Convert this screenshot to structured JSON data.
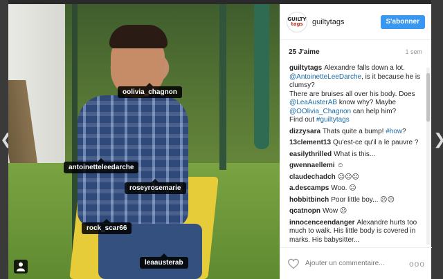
{
  "nav": {
    "prev_arrow": "❮",
    "next_arrow": "❯"
  },
  "photo": {
    "tags": [
      {
        "name": "oolivia_chagnon"
      },
      {
        "name": "antoinetteleedarche"
      },
      {
        "name": "roseyrosemarie"
      },
      {
        "name": "rock_scar66"
      },
      {
        "name": "leaausterab"
      }
    ]
  },
  "header": {
    "avatar_text_a": "GUILTY",
    "avatar_text_b": "tags",
    "username": "guiltytags",
    "follow_label": "S'abonner"
  },
  "stats": {
    "likes": "25 J'aime",
    "ago": "1 sem"
  },
  "caption": {
    "user": "guiltytags",
    "t1": "Alexandre falls down a lot. ",
    "m1": "@AntoinetteLeeDarche",
    "t2": ", is it because he is clumsy?",
    "t3": "There are bruises all over his body. Does ",
    "m2": "@LeaAusterAB",
    "t4": " know why? Maybe ",
    "m3": "@OOlivia_Chagnon",
    "t5": " can help him?",
    "t6": "Find out ",
    "h1": "#guiltytags"
  },
  "comments": [
    {
      "user": "dizzysara",
      "text": "Thats quite a bump! ",
      "tag": "#how",
      "after": "?"
    },
    {
      "user": "13clement13",
      "text": "Qu'est-ce qu'il a le pauvre ?"
    },
    {
      "user": "easilythrilled",
      "text": "What is this..."
    },
    {
      "user": "gwennaellemi",
      "text": "☺"
    },
    {
      "user": "claudechadch",
      "text": "☹☹☹"
    },
    {
      "user": "a.descamps",
      "text": "Woo. ☹"
    },
    {
      "user": "hobbitbinch",
      "text": "Poor little boy... ☹☹"
    },
    {
      "user": "qcatnopn",
      "text": "Wow ☹"
    },
    {
      "user": "innocenceendanger",
      "text": "Alexandre hurts too much to walk. His little body is covered in marks. His babysitter..."
    }
  ],
  "footer": {
    "placeholder": "Ajouter un commentaire...",
    "more": "ooo"
  }
}
